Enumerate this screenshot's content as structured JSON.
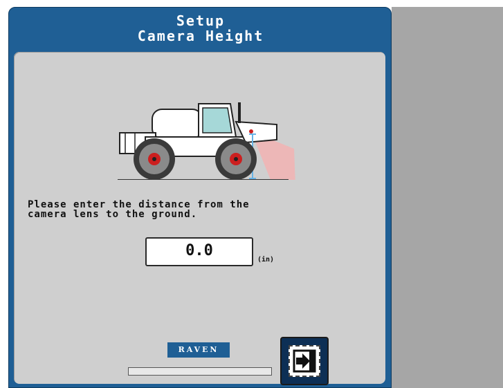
{
  "window": {
    "title_line1": "Setup",
    "title_line2": "Camera Height"
  },
  "instruction": "Please enter the distance from the\ncamera lens to the ground.",
  "height_input": {
    "value": "0.0",
    "unit": "(in)"
  },
  "brand": "RAVEN",
  "progress": {
    "fraction": 0.0
  },
  "icons": {
    "vehicle": "sprayer-camera-illustration",
    "next": "next-arrow-icon"
  },
  "colors": {
    "frame_blue": "#1f5f95",
    "panel_gray": "#cfcfcf",
    "camera_beam": "#f2b3b3",
    "wheel_hub": "#cc1f1f",
    "height_indicator": "#66b3e6"
  }
}
